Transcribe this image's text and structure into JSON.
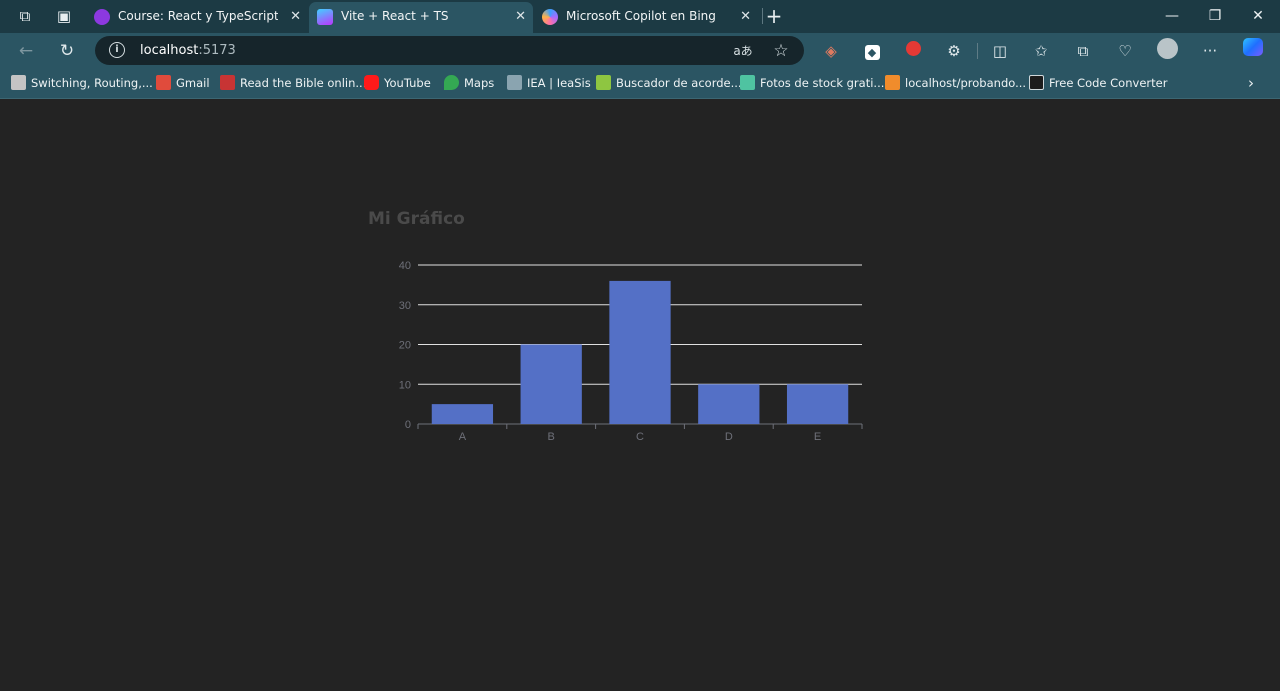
{
  "browser": {
    "tabs": [
      {
        "title": "Course: React y TypeScript - La Gu",
        "fav_color": "#8c39e0",
        "fav_glyph": "Ü"
      },
      {
        "title": "Vite + React + TS",
        "fav_color": "#f5c542",
        "fav_glyph": "▼"
      },
      {
        "title": "Microsoft Copilot en Bing",
        "fav_color": "#3aa0ff",
        "fav_glyph": "◆"
      }
    ],
    "new_tab_label": "+",
    "url_host": "localhost",
    "url_port": ":5173",
    "bookmarks": [
      {
        "label": "Switching, Routing,...",
        "color": "#c4c4c4"
      },
      {
        "label": "Gmail",
        "color": "#e04b3c"
      },
      {
        "label": "Read the Bible onlin...",
        "color": "#c73434"
      },
      {
        "label": "YouTube",
        "color": "#ff1a1a"
      },
      {
        "label": "Maps",
        "color": "#34a853"
      },
      {
        "label": "IEA | IeaSis",
        "color": "#8aa4b0"
      },
      {
        "label": "Buscador de acorde...",
        "color": "#8ec641"
      },
      {
        "label": "Fotos de stock grati...",
        "color": "#4fc3a1"
      },
      {
        "label": "localhost/probando...",
        "color": "#f08c2c"
      },
      {
        "label": "Free Code Converter",
        "color": "#1c1c1c"
      }
    ],
    "icons": [
      "back-icon",
      "refresh-icon",
      "info-icon",
      "translate-icon",
      "favorite-star-icon",
      "extensions-icon",
      "split-screen-icon",
      "favorites-icon",
      "collections-icon",
      "performance-icon",
      "profile-icon",
      "more-icon",
      "copilot-icon"
    ]
  },
  "page": {
    "chart_title": "Mi Gráfico"
  },
  "chart_data": {
    "type": "bar",
    "title": "Mi Gráfico",
    "categories": [
      "A",
      "B",
      "C",
      "D",
      "E"
    ],
    "values": [
      5,
      20,
      36,
      10,
      10
    ],
    "yticks": [
      "0",
      "10",
      "20",
      "30",
      "40"
    ],
    "ylim": [
      0,
      40
    ],
    "xlabel": "",
    "ylabel": "",
    "grid": true,
    "legend": "none",
    "colors": {
      "bar": "#5470c6",
      "grid": "#e0e0e0",
      "axis": "#6e7079",
      "label": "#6e7079"
    }
  }
}
